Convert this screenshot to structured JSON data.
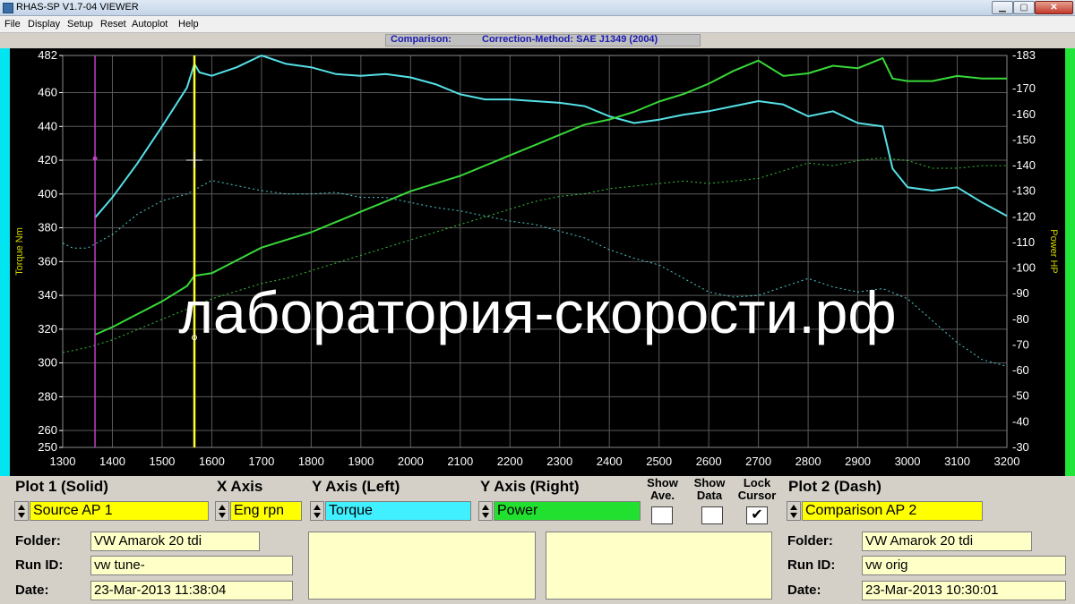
{
  "window": {
    "title": "RHAS-SP V1.7-04  VIEWER"
  },
  "menu": [
    "File",
    "Display",
    "Setup",
    "Reset",
    "Autoplot",
    "Help"
  ],
  "header": {
    "comparison": "Comparison:",
    "correction": "Correction-Method: SAE J1349 (2004)"
  },
  "watermark": "лаборатория-скорости.рф",
  "controls": {
    "plot1_label": "Plot 1 (Solid)",
    "xaxis_label": "X Axis",
    "yleft_label": "Y Axis (Left)",
    "yright_label": "Y Axis (Right)",
    "plot2_label": "Plot 2 (Dash)",
    "plot1_value": "Source AP 1",
    "xaxis_value": "Eng rpn",
    "yleft_value": "Torque",
    "yright_value": "Power",
    "plot2_value": "Comparison AP 2",
    "show_ave": "Show Ave.",
    "show_data": "Show Data",
    "lock_cursor": "Lock Cursor",
    "lock_checked": "✔",
    "folder_label": "Folder:",
    "runid_label": "Run ID:",
    "date_label": "Date:",
    "left": {
      "folder": "VW Amarok 20 tdi",
      "runid": "vw tune-",
      "date": "23-Mar-2013  11:38:04"
    },
    "right": {
      "folder": "VW Amarok 20 tdi",
      "runid": "vw orig",
      "date": "23-Mar-2013  10:30:01"
    }
  },
  "colors": {
    "torque": "#55e0e6",
    "power": "#38d838",
    "left_bar": "#00e5f0",
    "right_bar": "#22e53a",
    "cursor": "#ffff30",
    "marker": "#c040c0",
    "field_yellow": "#ffff00",
    "field_cyan": "#40f0ff",
    "field_green": "#22e030"
  },
  "chart_data": {
    "type": "line",
    "xlabel": "",
    "ylabel_left": "Torque Nm",
    "ylabel_right": "Power HP",
    "xlim": [
      1300,
      3200
    ],
    "ylim_left": [
      250,
      482
    ],
    "ylim_right": [
      30,
      183
    ],
    "x_ticks": [
      1300,
      1400,
      1500,
      1600,
      1700,
      1800,
      1900,
      2000,
      2100,
      2200,
      2300,
      2400,
      2500,
      2600,
      2700,
      2800,
      2900,
      3000,
      3100,
      3200
    ],
    "y_left_ticks": [
      250,
      260,
      280,
      300,
      320,
      340,
      360,
      380,
      400,
      420,
      440,
      460,
      482
    ],
    "y_right_ticks": [
      30,
      40,
      50,
      60,
      70,
      80,
      90,
      100,
      110,
      120,
      130,
      140,
      150,
      160,
      170,
      183
    ],
    "cursor_x": 1565,
    "marker_x": 1365,
    "grid": true,
    "series": [
      {
        "name": "Torque",
        "axis": "left",
        "style": "solid",
        "x": [
          1365,
          1400,
          1450,
          1500,
          1550,
          1565,
          1575,
          1600,
          1650,
          1700,
          1750,
          1800,
          1850,
          1900,
          1950,
          2000,
          2050,
          2100,
          2150,
          2200,
          2250,
          2300,
          2350,
          2400,
          2450,
          2500,
          2550,
          2600,
          2650,
          2700,
          2750,
          2800,
          2850,
          2900,
          2950,
          2970,
          3000,
          3050,
          3100,
          3150,
          3200
        ],
        "y": [
          386,
          398,
          418,
          440,
          463,
          477,
          472,
          470,
          475,
          482,
          477,
          475,
          471,
          470,
          471,
          469,
          465,
          459,
          456,
          456,
          455,
          454,
          452,
          446,
          442,
          444,
          447,
          449,
          452,
          455,
          453,
          446,
          449,
          442,
          440,
          415,
          404,
          402,
          404,
          395,
          387
        ]
      },
      {
        "name": "Power",
        "axis": "right",
        "style": "solid",
        "x": [
          1365,
          1400,
          1450,
          1500,
          1550,
          1565,
          1600,
          1650,
          1700,
          1750,
          1800,
          1850,
          1900,
          1950,
          2000,
          2050,
          2100,
          2150,
          2200,
          2250,
          2300,
          2350,
          2400,
          2450,
          2500,
          2550,
          2600,
          2650,
          2700,
          2750,
          2800,
          2850,
          2900,
          2950,
          2970,
          3000,
          3050,
          3100,
          3150,
          3200
        ],
        "y": [
          74,
          77,
          82,
          87,
          93,
          97,
          98,
          103,
          108,
          111,
          114,
          118,
          122,
          126,
          130,
          133,
          136,
          140,
          144,
          148,
          152,
          156,
          158,
          161,
          165,
          168,
          172,
          177,
          181,
          175,
          176,
          179,
          178,
          182,
          174,
          173,
          173,
          175,
          174,
          174
        ]
      },
      {
        "name": "Torque (comparison)",
        "axis": "left",
        "style": "dash",
        "x": [
          1300,
          1320,
          1350,
          1400,
          1450,
          1500,
          1550,
          1600,
          1650,
          1700,
          1750,
          1800,
          1850,
          1900,
          1950,
          2000,
          2050,
          2100,
          2150,
          2200,
          2250,
          2300,
          2350,
          2400,
          2450,
          2500,
          2550,
          2600,
          2650,
          2700,
          2750,
          2800,
          2850,
          2900,
          2950,
          3000,
          3050,
          3100,
          3150,
          3200
        ],
        "y": [
          371,
          368,
          368,
          376,
          388,
          396,
          400,
          408,
          405,
          402,
          400,
          400,
          401,
          398,
          398,
          395,
          392,
          390,
          387,
          384,
          382,
          378,
          374,
          367,
          362,
          358,
          350,
          342,
          339,
          340,
          345,
          350,
          345,
          342,
          344,
          338,
          325,
          312,
          302,
          298
        ]
      },
      {
        "name": "Power (comparison)",
        "axis": "right",
        "style": "dash",
        "x": [
          1300,
          1350,
          1400,
          1450,
          1500,
          1550,
          1600,
          1650,
          1700,
          1750,
          1800,
          1850,
          1900,
          1950,
          2000,
          2050,
          2100,
          2150,
          2200,
          2250,
          2300,
          2350,
          2400,
          2450,
          2500,
          2550,
          2600,
          2650,
          2700,
          2750,
          2800,
          2850,
          2900,
          2950,
          3000,
          3050,
          3100,
          3150,
          3200
        ],
        "y": [
          67,
          69,
          72,
          76,
          80,
          84,
          88,
          91,
          94,
          96,
          99,
          102,
          105,
          108,
          111,
          114,
          117,
          120,
          123,
          126,
          128,
          129,
          131,
          132,
          133,
          134,
          133,
          134,
          135,
          138,
          141,
          140,
          142,
          143,
          142,
          139,
          139,
          140,
          140
        ]
      }
    ]
  }
}
